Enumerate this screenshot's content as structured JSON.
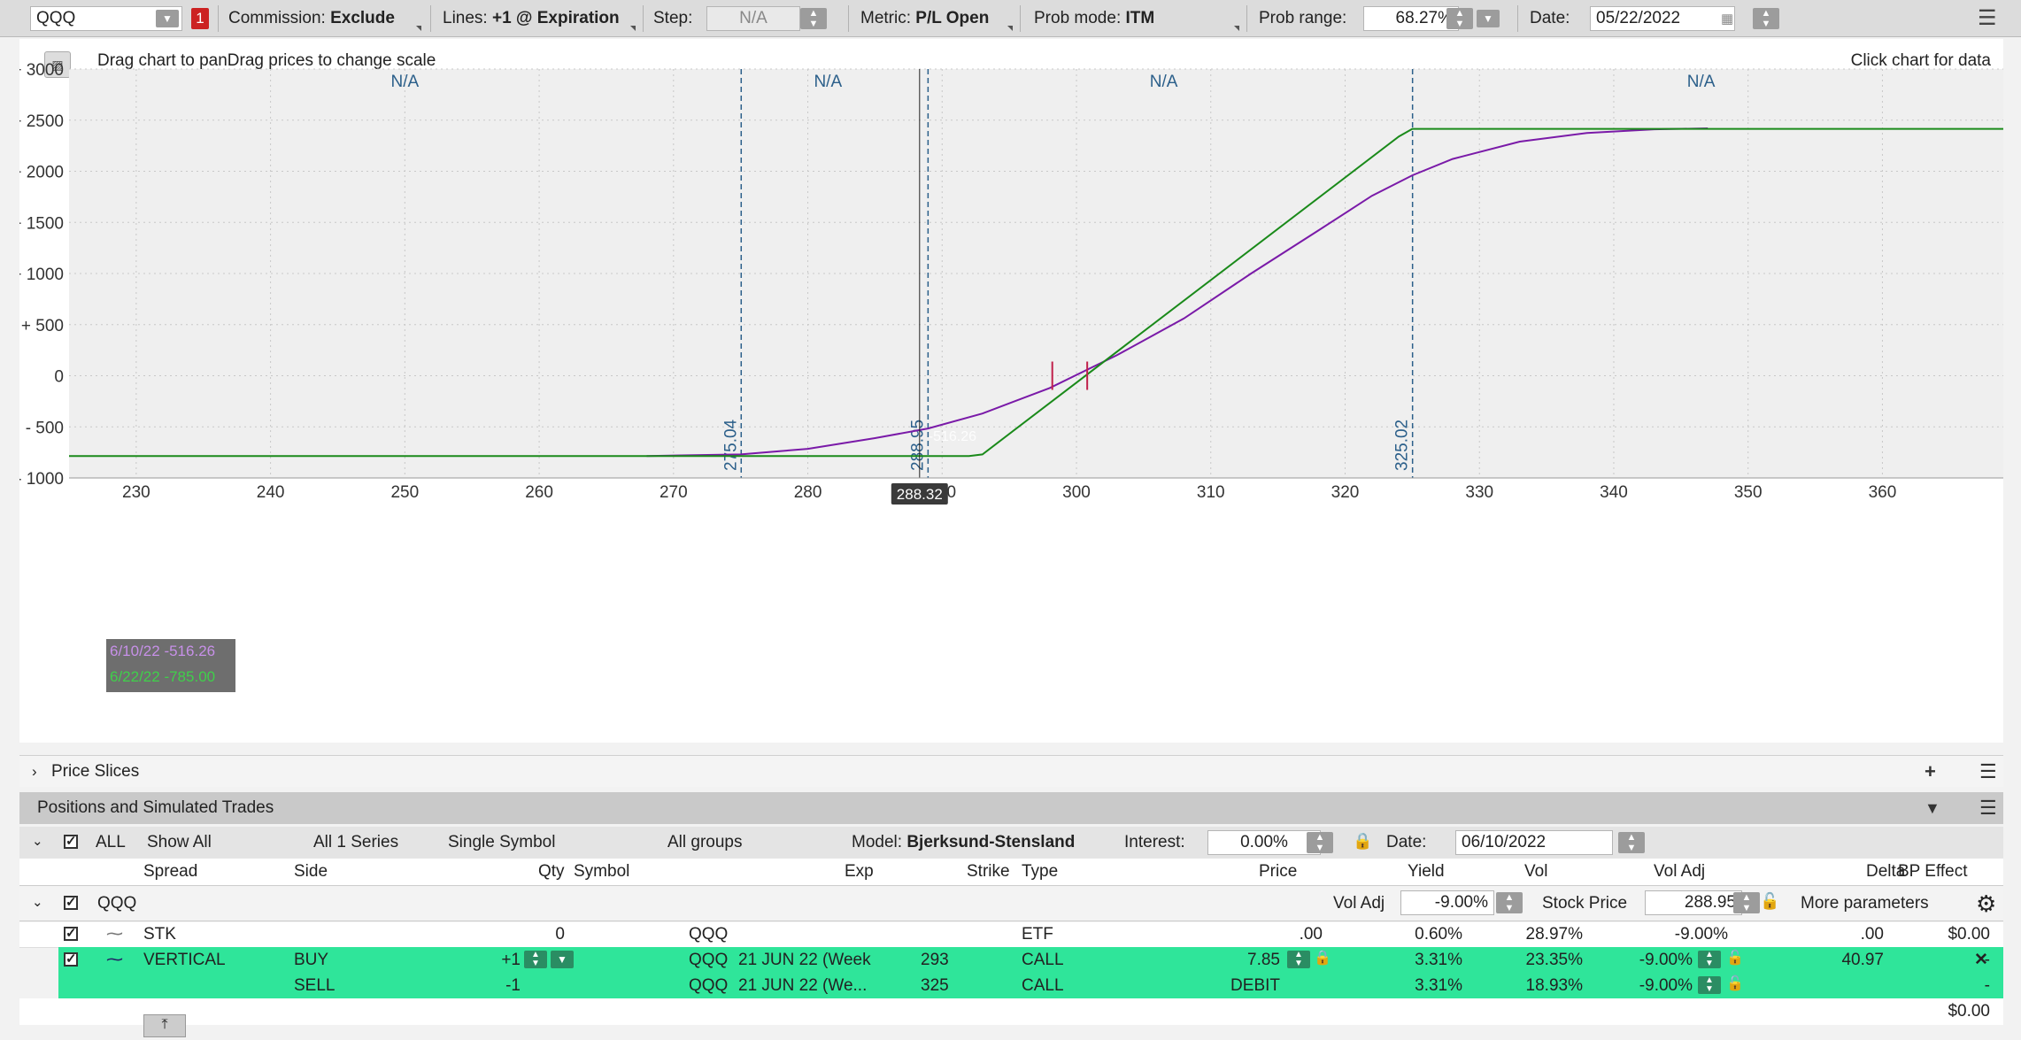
{
  "toolbar": {
    "symbol": "QQQ",
    "alert_badge": "1",
    "commission_label": "Commission:",
    "commission_value": "Exclude",
    "lines_label": "Lines:",
    "lines_value": "+1 @ Expiration",
    "step_label": "Step:",
    "step_value": "N/A",
    "metric_label": "Metric:",
    "metric_value": "P/L Open",
    "prob_mode_label": "Prob mode:",
    "prob_mode_value": "ITM",
    "prob_range_label": "Prob range:",
    "prob_range_value": "68.27%",
    "date_label": "Date:",
    "date_value": "05/22/2022"
  },
  "chart_hints": {
    "left": "Drag chart to panDrag prices to change scale",
    "right": "Click chart for data"
  },
  "chart_data": {
    "type": "line",
    "x_ticks": [
      "230",
      "240",
      "250",
      "260",
      "270",
      "280",
      "290",
      "300",
      "310",
      "320",
      "330",
      "340",
      "350",
      "360"
    ],
    "y_ticks": [
      "+ 3000",
      "+ 2500",
      "+ 2000",
      "+ 1500",
      "+ 1000",
      "+ 500",
      "0",
      "- 500",
      "- 1000"
    ],
    "xlim": [
      225,
      369
    ],
    "ylim": [
      -1000,
      3000
    ],
    "region_labels": [
      "N/A",
      "N/A",
      "N/A",
      "N/A"
    ],
    "region_label_x": [
      250,
      281.5,
      306.5,
      346.5
    ],
    "vlines": [
      {
        "x": 275.04,
        "label": "275.04"
      },
      {
        "x": 288.95,
        "label": "288.95"
      },
      {
        "x": 325.02,
        "label": "325.02"
      }
    ],
    "cursor_x": 288.32,
    "cursor_label": "288.32",
    "cursor_value": "-516.26",
    "series": [
      {
        "name": "6/10/22 -516.26",
        "color": "#7a1aa8",
        "points": [
          [
            268,
            -785
          ],
          [
            275,
            -770
          ],
          [
            280,
            -715
          ],
          [
            285,
            -610
          ],
          [
            288.95,
            -516
          ],
          [
            293,
            -370
          ],
          [
            298,
            -120
          ],
          [
            303,
            200
          ],
          [
            308,
            560
          ],
          [
            313,
            1000
          ],
          [
            318,
            1420
          ],
          [
            322,
            1760
          ],
          [
            325,
            1960
          ],
          [
            328,
            2120
          ],
          [
            333,
            2290
          ],
          [
            338,
            2375
          ],
          [
            343,
            2410
          ],
          [
            347,
            2420
          ]
        ]
      },
      {
        "name": "6/22/22 -785.00",
        "color": "#1a8a1a",
        "points": [
          [
            225,
            -785
          ],
          [
            292,
            -785
          ],
          [
            293,
            -770
          ],
          [
            324,
            2340
          ],
          [
            325,
            2415
          ],
          [
            369,
            2415
          ]
        ]
      }
    ],
    "breakeven_marks": [
      298.2,
      300.8
    ]
  },
  "price_slices": {
    "label": "Price Slices"
  },
  "positions": {
    "title": "Positions and Simulated Trades",
    "filter": {
      "all_label": "ALL",
      "show": "Show All",
      "series": "All 1 Series",
      "symbol_mode": "Single Symbol",
      "groups": "All groups",
      "model_label": "Model:",
      "model_value": "Bjerksund-Stensland",
      "interest_label": "Interest:",
      "interest_value": "0.00%",
      "date_label": "Date:",
      "date_value": "06/10/2022"
    },
    "columns": [
      "Spread",
      "Side",
      "Qty",
      "Symbol",
      "Exp",
      "Strike",
      "Type",
      "Price",
      "Yield",
      "Vol",
      "Vol Adj",
      "Delta",
      "BP Effect"
    ],
    "group": {
      "symbol": "QQQ",
      "vol_adj_label": "Vol Adj",
      "vol_adj_value": "-9.00%",
      "stock_price_label": "Stock Price",
      "stock_price_value": "288.95",
      "more_label": "More parameters"
    },
    "rows": [
      {
        "spread": "STK",
        "side": "",
        "qty": "0",
        "symbol": "QQQ",
        "exp": "",
        "strike": "",
        "type": "ETF",
        "price": ".00",
        "yield": "0.60%",
        "vol": "28.97%",
        "voladj": "-9.00%",
        "delta": ".00",
        "bp": "$0.00"
      },
      {
        "spread": "VERTICAL",
        "side": "BUY",
        "qty": "+1",
        "symbol": "QQQ",
        "exp": "21 JUN 22 (Week",
        "strike": "293",
        "type": "CALL",
        "price": "7.85",
        "yield": "3.31%",
        "vol": "23.35%",
        "voladj": "-9.00%",
        "delta": "40.97",
        "bp": "-"
      },
      {
        "spread": "",
        "side": "SELL",
        "qty": "-1",
        "symbol": "QQQ",
        "exp": "21 JUN 22 (We...",
        "strike": "325",
        "type": "CALL",
        "price": "DEBIT",
        "yield": "3.31%",
        "vol": "18.93%",
        "voladj": "-9.00%",
        "delta": "",
        "bp": "-"
      }
    ],
    "total_bp": "$0.00"
  }
}
